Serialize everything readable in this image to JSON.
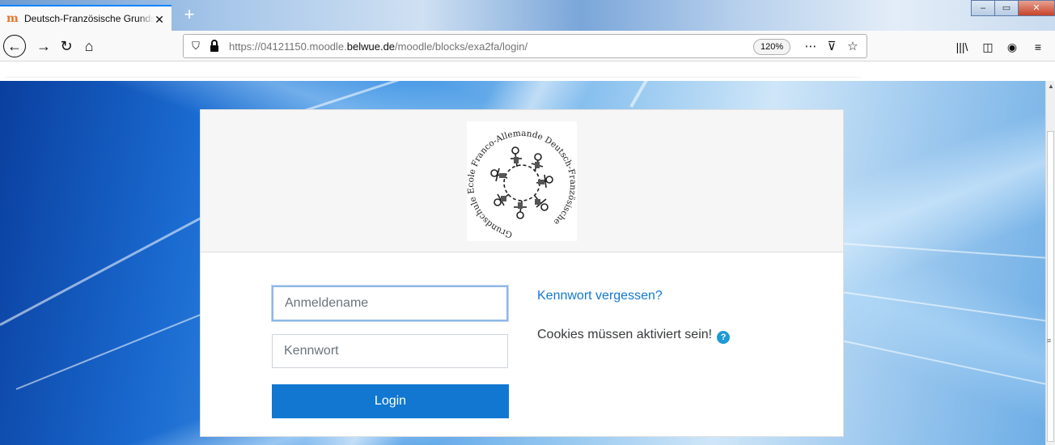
{
  "browser": {
    "tab_title": "Deutsch-Französische Grundschule Ecole Franco-Allemande",
    "tab_favicon": "moodle-m-icon",
    "new_tab_label": "+",
    "url_prefix": "https://04121150.moodle.",
    "url_domain": "belwue.de",
    "url_path": "/moodle/blocks/exa2fa/login/",
    "zoom_level": "120%",
    "accent_color": "#0a84ff"
  },
  "logo": {
    "alt": "Deutsch-Französische Grundschule Ecole Franco-Allemande",
    "ring_text": "Grundschule Ecole Franco-Allemande Deutsch-Französische"
  },
  "login": {
    "username_placeholder": "Anmeldename",
    "password_placeholder": "Kennwort",
    "login_button": "Login",
    "forgot_link": "Kennwort vergessen?",
    "cookies_notice": "Cookies müssen aktiviert sein!",
    "primary_color": "#1177d1"
  }
}
